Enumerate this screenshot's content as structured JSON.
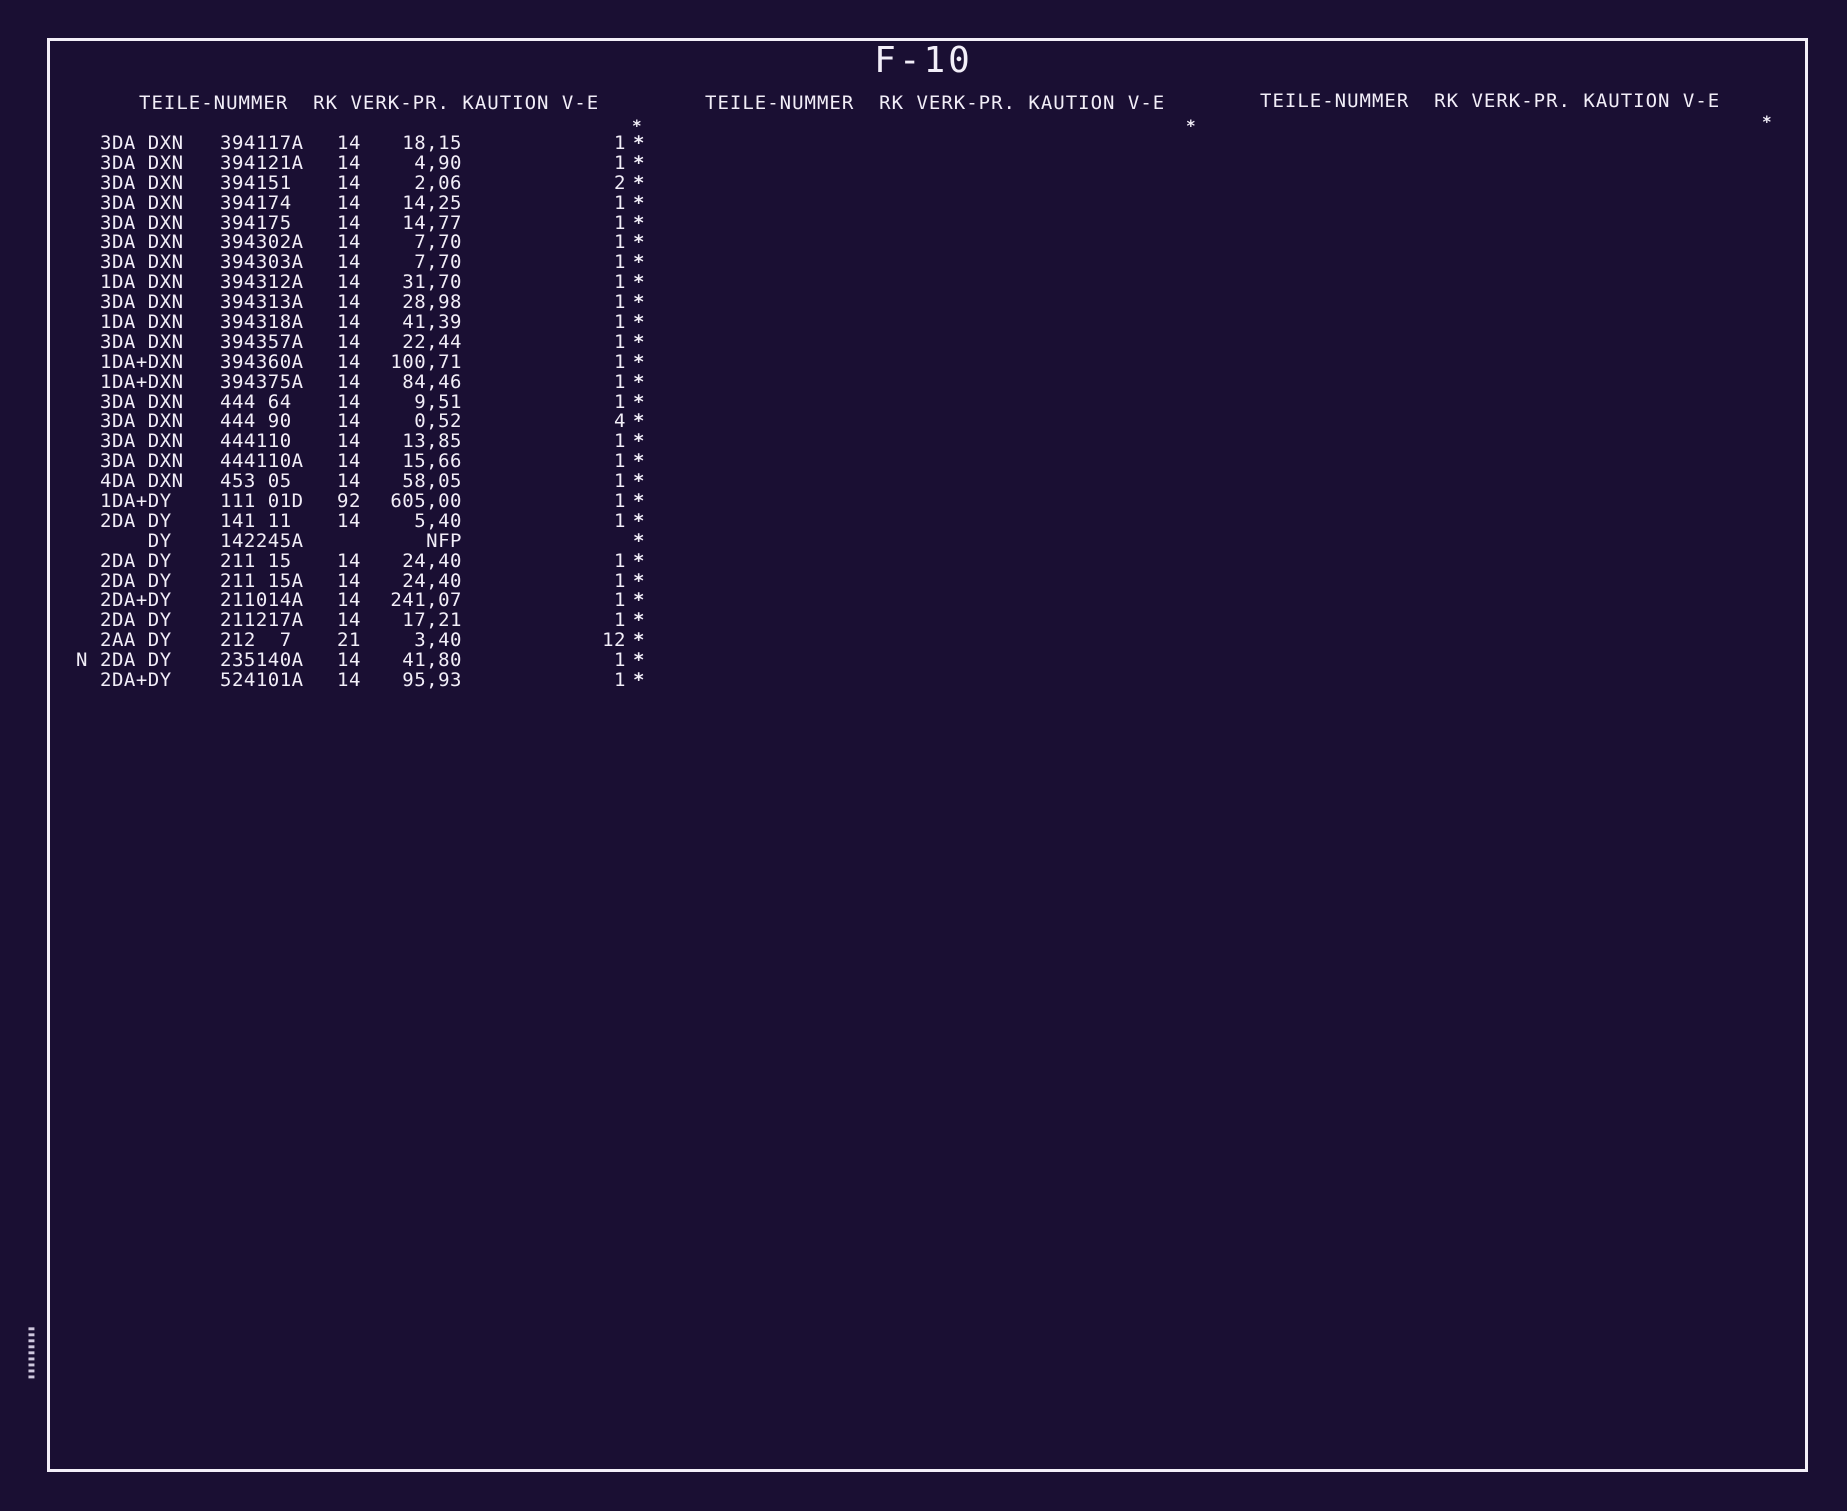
{
  "title": "F-10",
  "headers": [
    "TEILE-NUMMER  RK VERK-PR. KAUTION V-E",
    "TEILE-NUMMER  RK VERK-PR. KAUTION V-E",
    "TEILE-NUMMER  RK VERK-PR. KAUTION V-E"
  ],
  "star": "*",
  "rows": [
    {
      "flag": "",
      "prefix": "3DA DXN",
      "part": "394117A",
      "rk": "14",
      "price": "18,15",
      "kaution": "",
      "ve": "1"
    },
    {
      "flag": "",
      "prefix": "3DA DXN",
      "part": "394121A",
      "rk": "14",
      "price": "4,90",
      "kaution": "",
      "ve": "1"
    },
    {
      "flag": "",
      "prefix": "3DA DXN",
      "part": "394151",
      "rk": "14",
      "price": "2,06",
      "kaution": "",
      "ve": "2"
    },
    {
      "flag": "",
      "prefix": "3DA DXN",
      "part": "394174",
      "rk": "14",
      "price": "14,25",
      "kaution": "",
      "ve": "1"
    },
    {
      "flag": "",
      "prefix": "3DA DXN",
      "part": "394175",
      "rk": "14",
      "price": "14,77",
      "kaution": "",
      "ve": "1"
    },
    {
      "flag": "",
      "prefix": "3DA DXN",
      "part": "394302A",
      "rk": "14",
      "price": "7,70",
      "kaution": "",
      "ve": "1"
    },
    {
      "flag": "",
      "prefix": "3DA DXN",
      "part": "394303A",
      "rk": "14",
      "price": "7,70",
      "kaution": "",
      "ve": "1"
    },
    {
      "flag": "",
      "prefix": "1DA DXN",
      "part": "394312A",
      "rk": "14",
      "price": "31,70",
      "kaution": "",
      "ve": "1"
    },
    {
      "flag": "",
      "prefix": "3DA DXN",
      "part": "394313A",
      "rk": "14",
      "price": "28,98",
      "kaution": "",
      "ve": "1"
    },
    {
      "flag": "",
      "prefix": "1DA DXN",
      "part": "394318A",
      "rk": "14",
      "price": "41,39",
      "kaution": "",
      "ve": "1"
    },
    {
      "flag": "",
      "prefix": "3DA DXN",
      "part": "394357A",
      "rk": "14",
      "price": "22,44",
      "kaution": "",
      "ve": "1"
    },
    {
      "flag": "",
      "prefix": "1DA+DXN",
      "part": "394360A",
      "rk": "14",
      "price": "100,71",
      "kaution": "",
      "ve": "1"
    },
    {
      "flag": "",
      "prefix": "1DA+DXN",
      "part": "394375A",
      "rk": "14",
      "price": "84,46",
      "kaution": "",
      "ve": "1"
    },
    {
      "flag": "",
      "prefix": "3DA DXN",
      "part": "444 64",
      "rk": "14",
      "price": "9,51",
      "kaution": "",
      "ve": "1"
    },
    {
      "flag": "",
      "prefix": "3DA DXN",
      "part": "444 90",
      "rk": "14",
      "price": "0,52",
      "kaution": "",
      "ve": "4"
    },
    {
      "flag": "",
      "prefix": "3DA DXN",
      "part": "444110",
      "rk": "14",
      "price": "13,85",
      "kaution": "",
      "ve": "1"
    },
    {
      "flag": "",
      "prefix": "3DA DXN",
      "part": "444110A",
      "rk": "14",
      "price": "15,66",
      "kaution": "",
      "ve": "1"
    },
    {
      "flag": "",
      "prefix": "4DA DXN",
      "part": "453 05",
      "rk": "14",
      "price": "58,05",
      "kaution": "",
      "ve": "1"
    },
    {
      "flag": "",
      "prefix": "1DA+DY",
      "part": "111 01D",
      "rk": "92",
      "price": "605,00",
      "kaution": "",
      "ve": "1"
    },
    {
      "flag": "",
      "prefix": "2DA DY",
      "part": "141 11",
      "rk": "14",
      "price": "5,40",
      "kaution": "",
      "ve": "1"
    },
    {
      "flag": "",
      "prefix": "    DY",
      "part": "142245A",
      "rk": "",
      "price": "NFP",
      "kaution": "",
      "ve": ""
    },
    {
      "flag": "",
      "prefix": "2DA DY",
      "part": "211 15",
      "rk": "14",
      "price": "24,40",
      "kaution": "",
      "ve": "1"
    },
    {
      "flag": "",
      "prefix": "2DA DY",
      "part": "211 15A",
      "rk": "14",
      "price": "24,40",
      "kaution": "",
      "ve": "1"
    },
    {
      "flag": "",
      "prefix": "2DA+DY",
      "part": "211014A",
      "rk": "14",
      "price": "241,07",
      "kaution": "",
      "ve": "1"
    },
    {
      "flag": "",
      "prefix": "2DA DY",
      "part": "211217A",
      "rk": "14",
      "price": "17,21",
      "kaution": "",
      "ve": "1"
    },
    {
      "flag": "",
      "prefix": "2AA DY",
      "part": "212  7",
      "rk": "21",
      "price": "3,40",
      "kaution": "",
      "ve": "12"
    },
    {
      "flag": "N",
      "prefix": "2DA DY",
      "part": "235140A",
      "rk": "14",
      "price": "41,80",
      "kaution": "",
      "ve": "1"
    },
    {
      "flag": "",
      "prefix": "2DA+DY",
      "part": "524101A",
      "rk": "14",
      "price": "95,93",
      "kaution": "",
      "ve": "1"
    }
  ]
}
